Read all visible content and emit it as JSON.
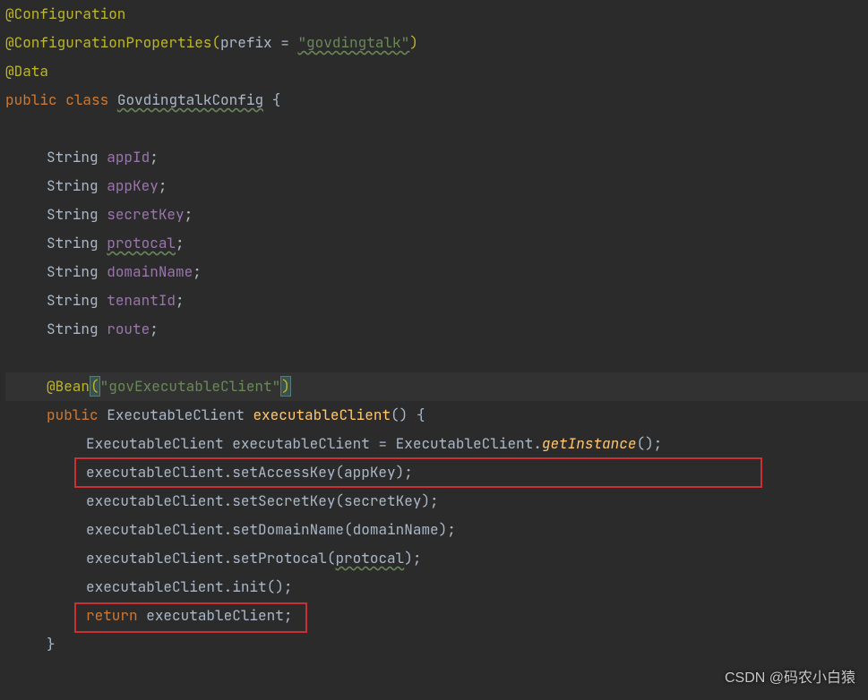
{
  "annotations": {
    "configuration": "@Configuration",
    "configProps": "@ConfigurationProperties",
    "prefixKey": "prefix",
    "equals": " = ",
    "prefixValue": "\"govdingtalk\"",
    "data": "@Data",
    "bean": "@Bean",
    "beanValue": "\"govExecutableClient\""
  },
  "decl": {
    "public": "public",
    "class": "class",
    "className": "GovdingtalkConfig",
    "openBrace": " {"
  },
  "fields": {
    "type": "String",
    "appId": "appId",
    "appKey": "appKey",
    "secretKey": "secretKey",
    "protocal": "protocal",
    "domainName": "domainName",
    "tenantId": "tenantId",
    "route": "route",
    "semi": ";"
  },
  "method": {
    "public": "public",
    "returnType": "ExecutableClient",
    "name": "executableClient",
    "sigEnd": "() {",
    "var": "executableClient",
    "getInstance": "getInstance",
    "dot": ".",
    "assign": " = ",
    "newClass": "ExecutableClient",
    "callEnd": "();",
    "setAccessKey": "setAccessKey",
    "setSecretKey": "setSecretKey",
    "setDomainName": "setDomainName",
    "setProtocal": "setProtocal",
    "init": "init",
    "return": "return",
    "semi": ";",
    "close": "}"
  },
  "params": {
    "appKey": "appKey",
    "secretKey": "secretKey",
    "domainName": "domainName",
    "protocal": "protocal"
  },
  "watermark": "CSDN @码农小白猿"
}
